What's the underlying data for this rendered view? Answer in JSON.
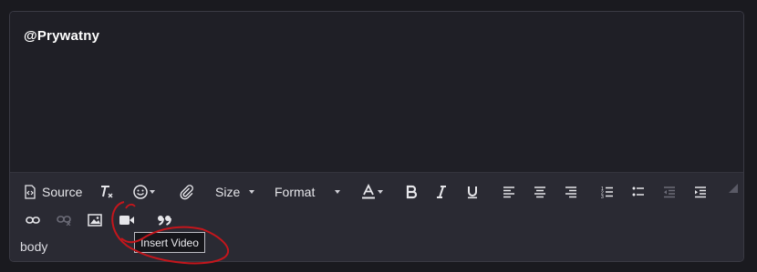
{
  "content": {
    "text": "@Prywatny"
  },
  "toolbar": {
    "source_label": "Source",
    "size_label": "Size",
    "format_label": "Format"
  },
  "elements_path": "body",
  "tooltip": "Insert Video",
  "icons": [
    "source-icon",
    "remove-format-icon",
    "smiley-icon",
    "paperclip-icon",
    "text-color-icon",
    "bold-icon",
    "italic-icon",
    "underline-icon",
    "align-left-icon",
    "align-center-icon",
    "align-right-icon",
    "numbered-list-icon",
    "bulleted-list-icon",
    "outdent-icon",
    "indent-icon",
    "link-icon",
    "unlink-icon",
    "image-icon",
    "video-icon",
    "quote-icon"
  ],
  "colors": {
    "background": "#1f1f26",
    "toolbar": "#2a2a33",
    "annotation": "#c4161c"
  }
}
